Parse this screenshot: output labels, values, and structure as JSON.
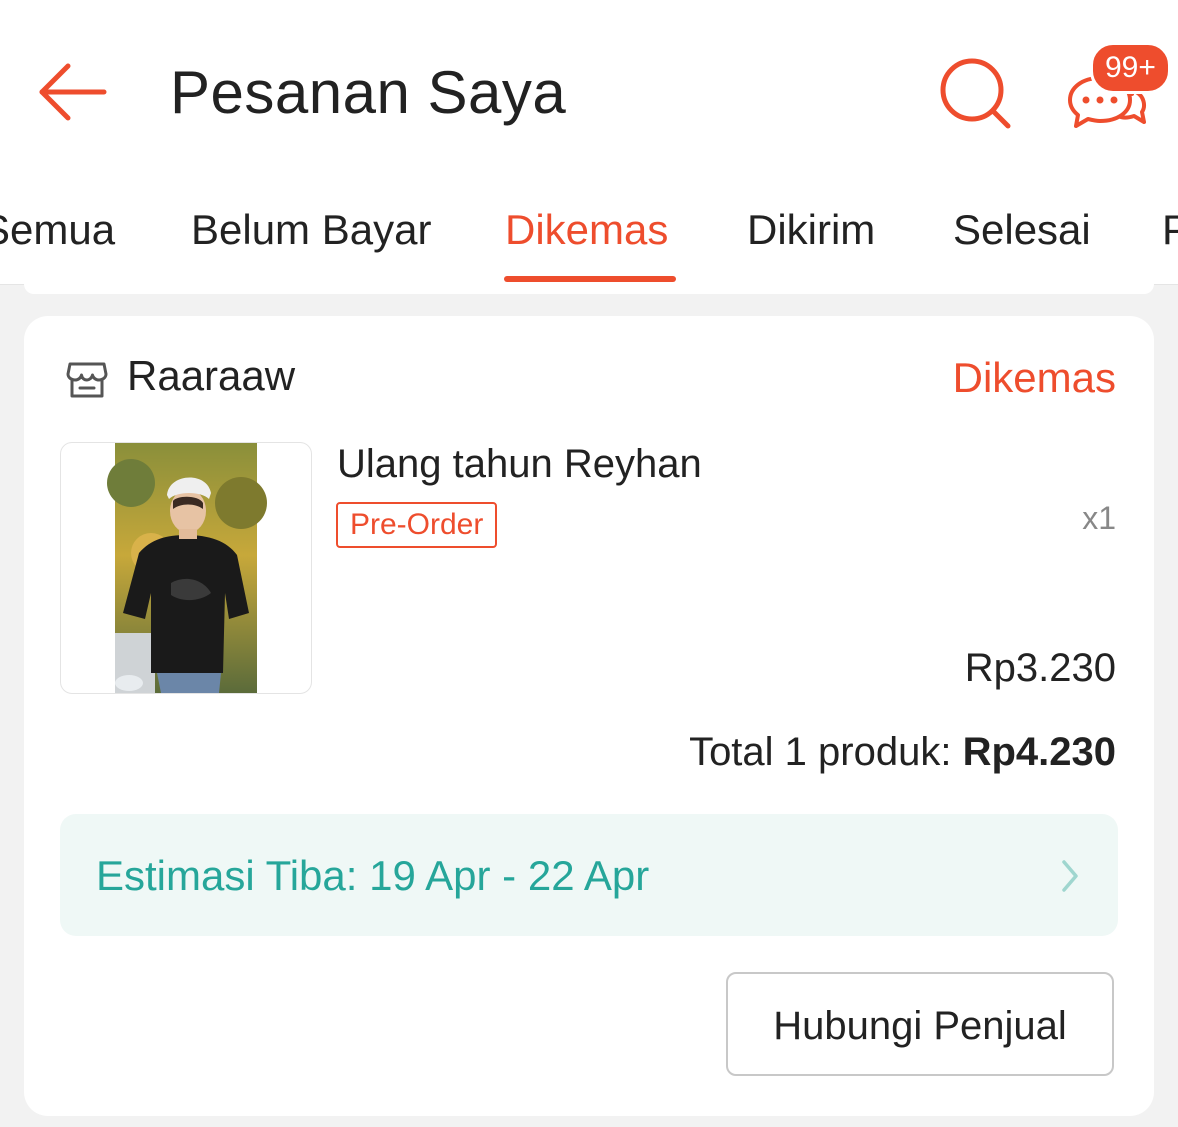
{
  "header": {
    "title": "Pesanan Saya",
    "back_icon": "arrow-left-icon",
    "search_icon": "search-icon",
    "chat_icon": "chat-bubbles-icon",
    "chat_badge": "99+",
    "accent_color": "#ee4d2d"
  },
  "tabs": [
    {
      "label": "Semua",
      "active": false
    },
    {
      "label": "Belum Bayar",
      "active": false
    },
    {
      "label": "Dikemas",
      "active": true
    },
    {
      "label": "Dikirim",
      "active": false
    },
    {
      "label": "Selesai",
      "active": false
    },
    {
      "label": "P",
      "active": false
    }
  ],
  "order": {
    "store_icon": "store-icon",
    "store_name": "Raaraaw",
    "status": "Dikemas",
    "product": {
      "name": "Ulang tahun Reyhan",
      "tag": "Pre-Order",
      "quantity": "x1",
      "price": "Rp3.230",
      "image": "product-photo"
    },
    "total_label": "Total 1 produk:",
    "total_value": "Rp4.230",
    "eta": "Estimasi Tiba: 19 Apr - 22 Apr",
    "eta_color": "#26a69a",
    "contact_button": "Hubungi Penjual"
  }
}
